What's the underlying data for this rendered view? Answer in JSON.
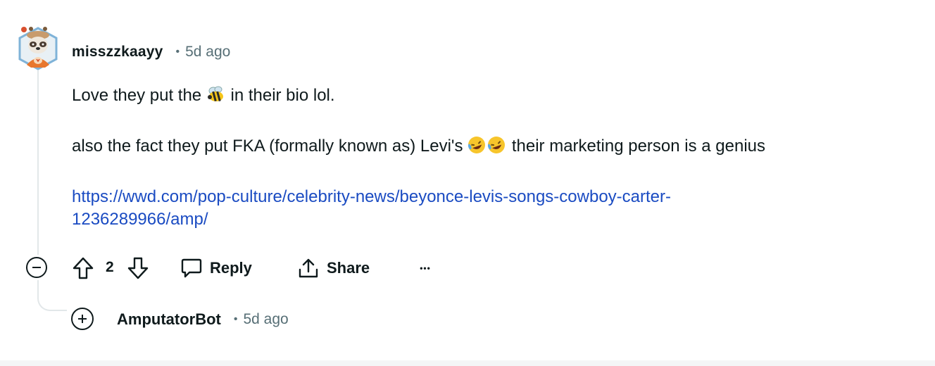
{
  "comment": {
    "username": "misszzkaayy",
    "separator": "•",
    "time": "5d ago",
    "avatar_icon": "raccoon-avatar-icon",
    "paragraph1_before": "Love they put the ",
    "paragraph1_emoji": "🐝",
    "paragraph1_after": " in their bio lol.",
    "paragraph2_before": "also the fact they put FKA (formally known as) Levi's ",
    "paragraph2_emoji": "🤣🤣",
    "paragraph2_after": " their marketing person is a genius",
    "link_line1": "https://wwd.com/pop-culture/celebrity-news/beyonce-levis-songs-cowboy-carter-",
    "link_line2": "1236289966/amp/"
  },
  "actions": {
    "vote_count": "2",
    "reply_label": "Reply",
    "share_label": "Share",
    "more_label": "•••"
  },
  "child_comment": {
    "username": "AmputatorBot",
    "separator": "•",
    "time": "5d ago"
  },
  "colors": {
    "text": "#0f1a1c",
    "meta": "#576f76",
    "link": "#1a4bc2",
    "thread": "#e2e7e9"
  }
}
